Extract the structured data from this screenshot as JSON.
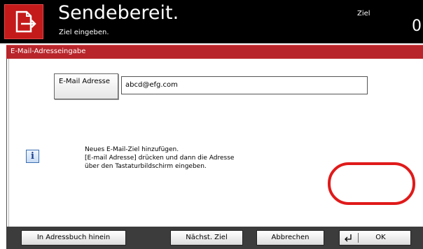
{
  "header": {
    "title": "Sendebereit.",
    "subtitle": "Ziel eingeben.",
    "destination_label": "Ziel",
    "destination_count": "0",
    "icon": "send-document-icon"
  },
  "dialog": {
    "title": "E-Mail-Adresseingabe",
    "email_button_label": "E-Mail Adresse",
    "email_value": "abcd@efg.com",
    "info_icon": "info-icon",
    "info_lines": [
      "Neues E-Mail-Ziel hinzufügen.",
      "[E-mail Adresse] drücken und dann die Adresse",
      "über den Tastaturbildschirm eingeben."
    ]
  },
  "buttons": {
    "add_to_addressbook": "In Adressbuch hinein",
    "next_destination": "Nächst. Ziel",
    "cancel": "Abbrechen",
    "ok": "OK",
    "ok_icon": "enter-arrow-icon"
  },
  "colors": {
    "header_bg": "#000000",
    "accent_red": "#c41a1a",
    "titlebar_red": "#b8252a",
    "highlight_ring": "#e01a1a",
    "bottombar_bg": "#3c3c3c"
  }
}
